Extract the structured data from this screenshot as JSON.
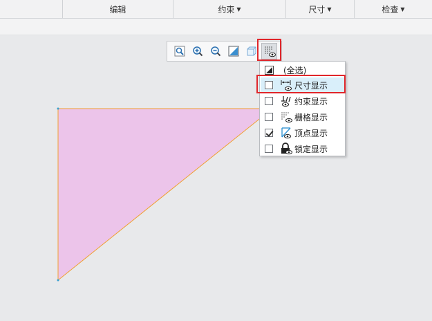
{
  "ribbon": {
    "tabs": [
      {
        "label": "编辑",
        "has_menu": false
      },
      {
        "label": "约束",
        "has_menu": true
      },
      {
        "label": "尺寸",
        "has_menu": true
      },
      {
        "label": "检查",
        "has_menu": true
      }
    ]
  },
  "toolbar": {
    "buttons": [
      {
        "name": "zoom-fit-button",
        "icon": "zoom-fit-icon"
      },
      {
        "name": "zoom-in-button",
        "icon": "zoom-in-icon"
      },
      {
        "name": "zoom-out-button",
        "icon": "zoom-out-icon"
      },
      {
        "name": "sketch-view-button",
        "icon": "sketch-view-icon"
      },
      {
        "name": "display-style-button",
        "icon": "cube-display-icon"
      },
      {
        "name": "sketcher-display-button",
        "icon": "grid-eye-icon",
        "active": true
      }
    ]
  },
  "display_menu": {
    "select_all_label": "(全选)",
    "items": [
      {
        "label": "尺寸显示",
        "checked": false,
        "icon": "dimension-display-icon",
        "hovered": true
      },
      {
        "label": "约束显示",
        "checked": false,
        "icon": "constraint-display-icon"
      },
      {
        "label": "栅格显示",
        "checked": false,
        "icon": "grid-display-icon"
      },
      {
        "label": "顶点显示",
        "checked": true,
        "icon": "vertex-display-icon"
      },
      {
        "label": "锁定显示",
        "checked": false,
        "icon": "lock-display-icon"
      }
    ]
  },
  "colors": {
    "triangle_fill": "#ecc4ea",
    "triangle_edge": "#f0a030",
    "highlight": "#e0262b",
    "hover_bg": "#d9effa"
  }
}
